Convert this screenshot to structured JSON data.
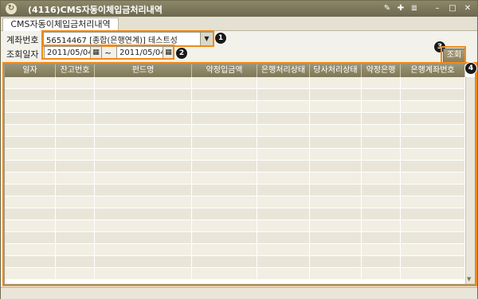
{
  "window": {
    "title": "(4116)CMS자동이체입금처리내역",
    "app_icon": "refresh-icon",
    "controls": [
      "pin-icon",
      "fit-icon",
      "menu-icon",
      "minimize-icon",
      "restore-icon",
      "close-icon"
    ]
  },
  "tab": {
    "label": "CMS자동이체입금처리내역"
  },
  "account": {
    "label": "계좌번호",
    "value": "56514467 [종합(은행연계)] 테스트성"
  },
  "date": {
    "label": "조회일자",
    "from": "2011/05/04",
    "separator": "~",
    "to": "2011/05/04"
  },
  "search_button": "조회",
  "badges": [
    "1",
    "2",
    "3",
    "4"
  ],
  "grid": {
    "columns": [
      "일자",
      "잔고번호",
      "펀드명",
      "약정입금액",
      "은행처리상태",
      "당사처리상태",
      "약정은행",
      "은행계좌번호"
    ],
    "row_count": 17
  },
  "colors": {
    "highlight": "#f08a1a",
    "titlebar": "#7c7758",
    "header": "#8a8464"
  }
}
